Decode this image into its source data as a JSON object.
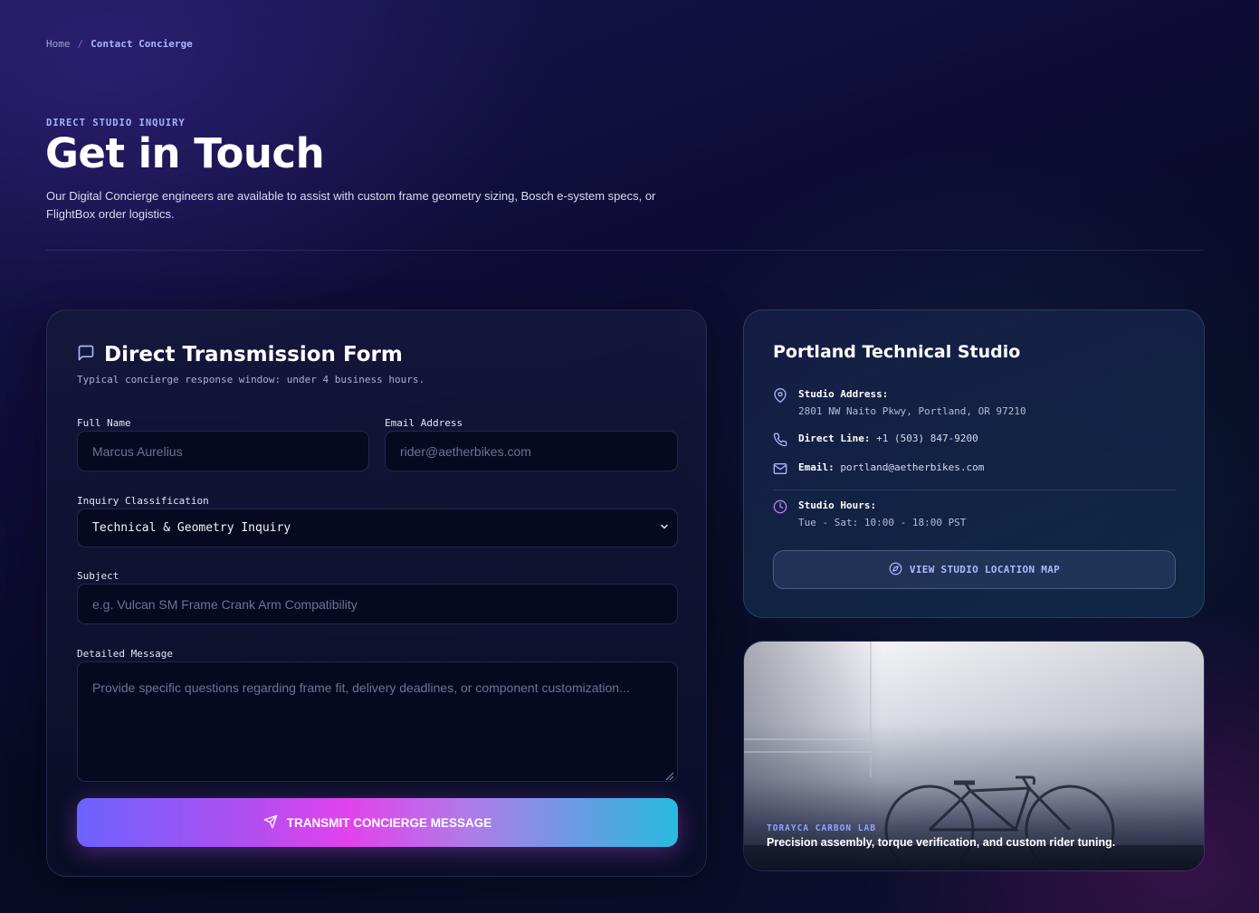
{
  "breadcrumb": {
    "home": "Home",
    "separator": "/",
    "current": "Contact Concierge"
  },
  "hero": {
    "eyebrow": "DIRECT STUDIO INQUIRY",
    "title": "Get in Touch",
    "intro": "Our Digital Concierge engineers are available to assist with custom frame geometry sizing, Bosch e-system specs, or FlightBox order logistics."
  },
  "form": {
    "icon": "message-square-icon",
    "title": "Direct Transmission Form",
    "subtitle": "Typical concierge response window: under 4 business hours.",
    "full_name": {
      "label": "Full Name",
      "placeholder": "Marcus Aurelius"
    },
    "email": {
      "label": "Email Address",
      "placeholder": "rider@aetherbikes.com"
    },
    "inquiry": {
      "label": "Inquiry Classification",
      "selected": "Technical & Geometry Inquiry"
    },
    "subject": {
      "label": "Subject",
      "placeholder": "e.g. Vulcan SM Frame Crank Arm Compatibility"
    },
    "message": {
      "label": "Detailed Message",
      "placeholder": "Provide specific questions regarding frame fit, delivery deadlines, or component customization..."
    },
    "submit_label": "TRANSMIT CONCIERGE MESSAGE",
    "submit_icon": "send-icon"
  },
  "studio": {
    "title": "Portland Technical Studio",
    "address_label": "Studio Address:",
    "address_value": "2801 NW Naito Pkwy, Portland, OR 97210",
    "phone_label": "Direct Line:",
    "phone_value": "+1 (503) 847-9200",
    "email_label": "Email:",
    "email_value": "portland@aetherbikes.com",
    "hours_label": "Studio Hours:",
    "hours_value": "Tue - Sat: 10:00 - 18:00 PST",
    "map_button": "VIEW STUDIO LOCATION MAP"
  },
  "photo": {
    "tag": "TORAYCA CARBON LAB",
    "caption": "Precision assembly, torque verification, and custom rider tuning."
  },
  "colors": {
    "accent_blue": "#a9b6ff",
    "accent_purple": "#b55cf0",
    "accent_cyan": "#28bbe0",
    "hours_icon": "#c07cf5"
  }
}
